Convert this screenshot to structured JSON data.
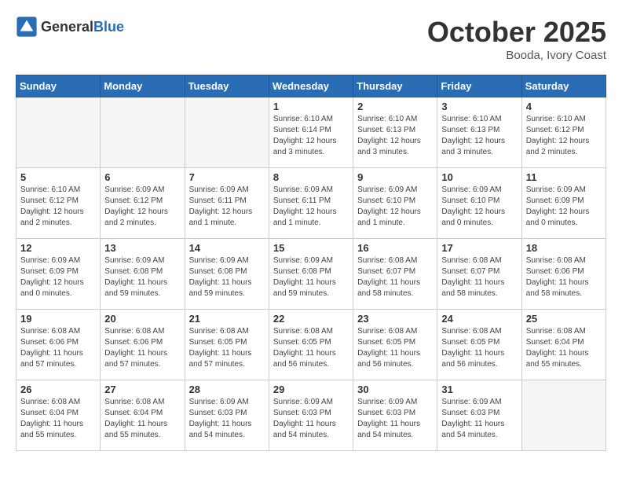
{
  "header": {
    "logo_general": "General",
    "logo_blue": "Blue",
    "month": "October 2025",
    "location": "Booda, Ivory Coast"
  },
  "days_of_week": [
    "Sunday",
    "Monday",
    "Tuesday",
    "Wednesday",
    "Thursday",
    "Friday",
    "Saturday"
  ],
  "weeks": [
    [
      {
        "day": "",
        "info": ""
      },
      {
        "day": "",
        "info": ""
      },
      {
        "day": "",
        "info": ""
      },
      {
        "day": "1",
        "info": "Sunrise: 6:10 AM\nSunset: 6:14 PM\nDaylight: 12 hours\nand 3 minutes."
      },
      {
        "day": "2",
        "info": "Sunrise: 6:10 AM\nSunset: 6:13 PM\nDaylight: 12 hours\nand 3 minutes."
      },
      {
        "day": "3",
        "info": "Sunrise: 6:10 AM\nSunset: 6:13 PM\nDaylight: 12 hours\nand 3 minutes."
      },
      {
        "day": "4",
        "info": "Sunrise: 6:10 AM\nSunset: 6:12 PM\nDaylight: 12 hours\nand 2 minutes."
      }
    ],
    [
      {
        "day": "5",
        "info": "Sunrise: 6:10 AM\nSunset: 6:12 PM\nDaylight: 12 hours\nand 2 minutes."
      },
      {
        "day": "6",
        "info": "Sunrise: 6:09 AM\nSunset: 6:12 PM\nDaylight: 12 hours\nand 2 minutes."
      },
      {
        "day": "7",
        "info": "Sunrise: 6:09 AM\nSunset: 6:11 PM\nDaylight: 12 hours\nand 1 minute."
      },
      {
        "day": "8",
        "info": "Sunrise: 6:09 AM\nSunset: 6:11 PM\nDaylight: 12 hours\nand 1 minute."
      },
      {
        "day": "9",
        "info": "Sunrise: 6:09 AM\nSunset: 6:10 PM\nDaylight: 12 hours\nand 1 minute."
      },
      {
        "day": "10",
        "info": "Sunrise: 6:09 AM\nSunset: 6:10 PM\nDaylight: 12 hours\nand 0 minutes."
      },
      {
        "day": "11",
        "info": "Sunrise: 6:09 AM\nSunset: 6:09 PM\nDaylight: 12 hours\nand 0 minutes."
      }
    ],
    [
      {
        "day": "12",
        "info": "Sunrise: 6:09 AM\nSunset: 6:09 PM\nDaylight: 12 hours\nand 0 minutes."
      },
      {
        "day": "13",
        "info": "Sunrise: 6:09 AM\nSunset: 6:08 PM\nDaylight: 11 hours\nand 59 minutes."
      },
      {
        "day": "14",
        "info": "Sunrise: 6:09 AM\nSunset: 6:08 PM\nDaylight: 11 hours\nand 59 minutes."
      },
      {
        "day": "15",
        "info": "Sunrise: 6:09 AM\nSunset: 6:08 PM\nDaylight: 11 hours\nand 59 minutes."
      },
      {
        "day": "16",
        "info": "Sunrise: 6:08 AM\nSunset: 6:07 PM\nDaylight: 11 hours\nand 58 minutes."
      },
      {
        "day": "17",
        "info": "Sunrise: 6:08 AM\nSunset: 6:07 PM\nDaylight: 11 hours\nand 58 minutes."
      },
      {
        "day": "18",
        "info": "Sunrise: 6:08 AM\nSunset: 6:06 PM\nDaylight: 11 hours\nand 58 minutes."
      }
    ],
    [
      {
        "day": "19",
        "info": "Sunrise: 6:08 AM\nSunset: 6:06 PM\nDaylight: 11 hours\nand 57 minutes."
      },
      {
        "day": "20",
        "info": "Sunrise: 6:08 AM\nSunset: 6:06 PM\nDaylight: 11 hours\nand 57 minutes."
      },
      {
        "day": "21",
        "info": "Sunrise: 6:08 AM\nSunset: 6:05 PM\nDaylight: 11 hours\nand 57 minutes."
      },
      {
        "day": "22",
        "info": "Sunrise: 6:08 AM\nSunset: 6:05 PM\nDaylight: 11 hours\nand 56 minutes."
      },
      {
        "day": "23",
        "info": "Sunrise: 6:08 AM\nSunset: 6:05 PM\nDaylight: 11 hours\nand 56 minutes."
      },
      {
        "day": "24",
        "info": "Sunrise: 6:08 AM\nSunset: 6:05 PM\nDaylight: 11 hours\nand 56 minutes."
      },
      {
        "day": "25",
        "info": "Sunrise: 6:08 AM\nSunset: 6:04 PM\nDaylight: 11 hours\nand 55 minutes."
      }
    ],
    [
      {
        "day": "26",
        "info": "Sunrise: 6:08 AM\nSunset: 6:04 PM\nDaylight: 11 hours\nand 55 minutes."
      },
      {
        "day": "27",
        "info": "Sunrise: 6:08 AM\nSunset: 6:04 PM\nDaylight: 11 hours\nand 55 minutes."
      },
      {
        "day": "28",
        "info": "Sunrise: 6:09 AM\nSunset: 6:03 PM\nDaylight: 11 hours\nand 54 minutes."
      },
      {
        "day": "29",
        "info": "Sunrise: 6:09 AM\nSunset: 6:03 PM\nDaylight: 11 hours\nand 54 minutes."
      },
      {
        "day": "30",
        "info": "Sunrise: 6:09 AM\nSunset: 6:03 PM\nDaylight: 11 hours\nand 54 minutes."
      },
      {
        "day": "31",
        "info": "Sunrise: 6:09 AM\nSunset: 6:03 PM\nDaylight: 11 hours\nand 54 minutes."
      },
      {
        "day": "",
        "info": ""
      }
    ]
  ]
}
